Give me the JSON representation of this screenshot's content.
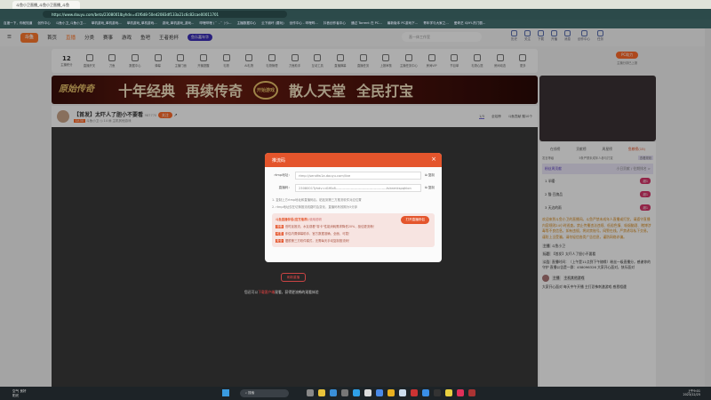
{
  "browser": {
    "tab_title": "斗鱼小卫直播_斗鱼小卫直播_斗鱼",
    "url": "https://www.douyu.com/beta/2308001lbyhdv=d1f6d8-50ed2083df133a21c6c82cae00011701",
    "bookmarks": [
      "百度一下，你就知道",
      "创作中心",
      "斗鱼小卫_斗鱼小卫...",
      "单机游戏_单机游戏...",
      "单机游戏_单机游戏...",
      "游戏_单机游戏_游戏...",
      "哔哩哔哩 ( ゜- ゜)つ...",
      "主播数据中心",
      "云下崩坏 (要玩)",
      "创作中心 - 哔哩哔...",
      "抖音创作者中心",
      "通过 Torrent 在 PC...",
      "最新版本 PC游戏下...",
      "青年学与大家之...",
      "爱奇艺 iQIYI-热门剧..."
    ]
  },
  "header": {
    "logo": "斗鱼",
    "nav": [
      "首页",
      "直播",
      "分类",
      "赛事",
      "游戏",
      "鱼吧",
      "王者抢杯"
    ],
    "promo_label": "鱼乐嘉年华",
    "search_placeholder": "直一体工作室",
    "icons": [
      {
        "label": "历史",
        "icon": "clock-icon"
      },
      {
        "label": "关注",
        "icon": "heart-icon"
      },
      {
        "label": "下载",
        "icon": "download-icon"
      },
      {
        "label": "开播",
        "icon": "camera-icon"
      },
      {
        "label": "消息",
        "icon": "bell-icon"
      },
      {
        "label": "创作中心",
        "icon": "bulb-icon"
      },
      {
        "label": "任务",
        "icon": "task-icon"
      }
    ]
  },
  "categories": {
    "score_value": "12",
    "score_label": "主播积分",
    "items": [
      "直播开关",
      "刀鱼",
      "数据中心",
      "弹幕",
      "主播门面",
      "开播提醒",
      "礼物",
      "AI礼物",
      "礼物管理",
      "刀鱼助手",
      "互动工具",
      "直播弹幕",
      "直播任务",
      "上报审核",
      "主播任务中心",
      "房间VIP",
      "节目单",
      "礼物心愿",
      "房间动态",
      "更多"
    ],
    "pc_button": "PC助力",
    "pc_sub": "主播分钟已上报"
  },
  "banner": {
    "logo": "原始传奇",
    "text": [
      "十年经典",
      "再续传奇",
      "散人天堂",
      "全民打宝"
    ],
    "badge": "开始游戏"
  },
  "stream": {
    "title": "【首发】太吓人了胆小不要看",
    "room_id": "987770",
    "follow_label": "关注",
    "level": "LV.30",
    "streamer": "斗鱼小卫",
    "viewers": "14",
    "category": "主机其他游戏",
    "tabs": [
      "1/3",
      "全站榜",
      "斗鱼贡献 赠10个"
    ]
  },
  "modal": {
    "title": "推流码",
    "close": "×",
    "rtmp_label": "rtmp地址：",
    "rtmp_value": "rtmp://sendfw1a.douyu.com/live",
    "code_label": "直播码：",
    "code_value": "2308001Tyhdv=d1f6c8--------------------------------------------tvbnmkspqhlon",
    "copy_label": "复制",
    "tips": [
      "1. 复制上方rtmp地址和直播码后，粘贴到第三方推流软件对应位置",
      "2. rtmp地址仅在切换推流线路时会变化，直播码有效期为5分钟"
    ],
    "promo_title": "斗鱼直播伴侣(官方推荐)",
    "promo_sub": "使用说明",
    "open_button": "打开直播伴侣",
    "promo_lines": [
      {
        "tag": "流畅",
        "text": "低时延推流，水友观看\"零卡\"性能消耗需求降低20%，极佳更流畅！"
      },
      {
        "tag": "可靠",
        "text": "伴侣内置弹幕助手，官方数据准确、全面、可靠！"
      },
      {
        "tag": "安全",
        "text": "摆脱第三方软件模式，无需每天手动复制推流码！"
      }
    ]
  },
  "video": {
    "refresh_button": "刷新重播",
    "hint_pre": "您还可以",
    "hint_link": "下载客户端",
    "hint_post": "观看，获得更流畅的观看体验"
  },
  "rightpanel": {
    "tabs": [
      "在线榜",
      "贡献榜",
      "周星榜",
      "鱼粮榜(15)"
    ],
    "filter": "发言等级",
    "filter_hint": "5条严禁未成年人参与打赏",
    "filter_btn": "查看规则",
    "fans_title": "粉丝周贡献",
    "fans_more": "小日贡献 / 往期排名 >",
    "ranks": [
      {
        "name": "半暖·",
        "badge": "超1"
      },
      {
        "name": "猫·豆旗品",
        "badge": "超1"
      },
      {
        "name": "天边的雨",
        "badge": "超1"
      }
    ],
    "notice": "欢迎来到斗鱼小卫的直播间。斗鱼严禁未成年人直播或打赏，请遵守直播内容规则24小时巡查。禁止传播违法违规、低俗色情、吸烟酗酒、赌博涉毒等不良信息，如有违规，将封禁账号。网警在线。严禁诱导私下交易，谨防上当受骗。请勿轻信各类广告信息，谨防网络诈骗。",
    "anchor_label": "主播",
    "anchor": "斗鱼小卫",
    "title_label": "标题",
    "title": "【首发】太吓人了胆小不要看",
    "notice_label": "公告",
    "announcement": "直播时间：（上午是11点到下午随缘）粉丝一级直播分，感谢你的守护 直播公告是一群：458096326 大家开心面对，快乐面对",
    "chat_user_tag": "主播",
    "chat_user": "主机其他游戏",
    "chat_msg": "大家开心面对 每天中午开播 主打恐怖刺激游戏 感恩相遇"
  },
  "taskbar": {
    "weather": "空气 良好",
    "weather_sub": "阳光",
    "search": "搜索",
    "time": "上午9:01",
    "date": "2023/12/25"
  },
  "colors": {
    "accent": "#ff6a2a",
    "modal_header": "#e4552c",
    "browser_toolbar": "#2c4a4a"
  }
}
